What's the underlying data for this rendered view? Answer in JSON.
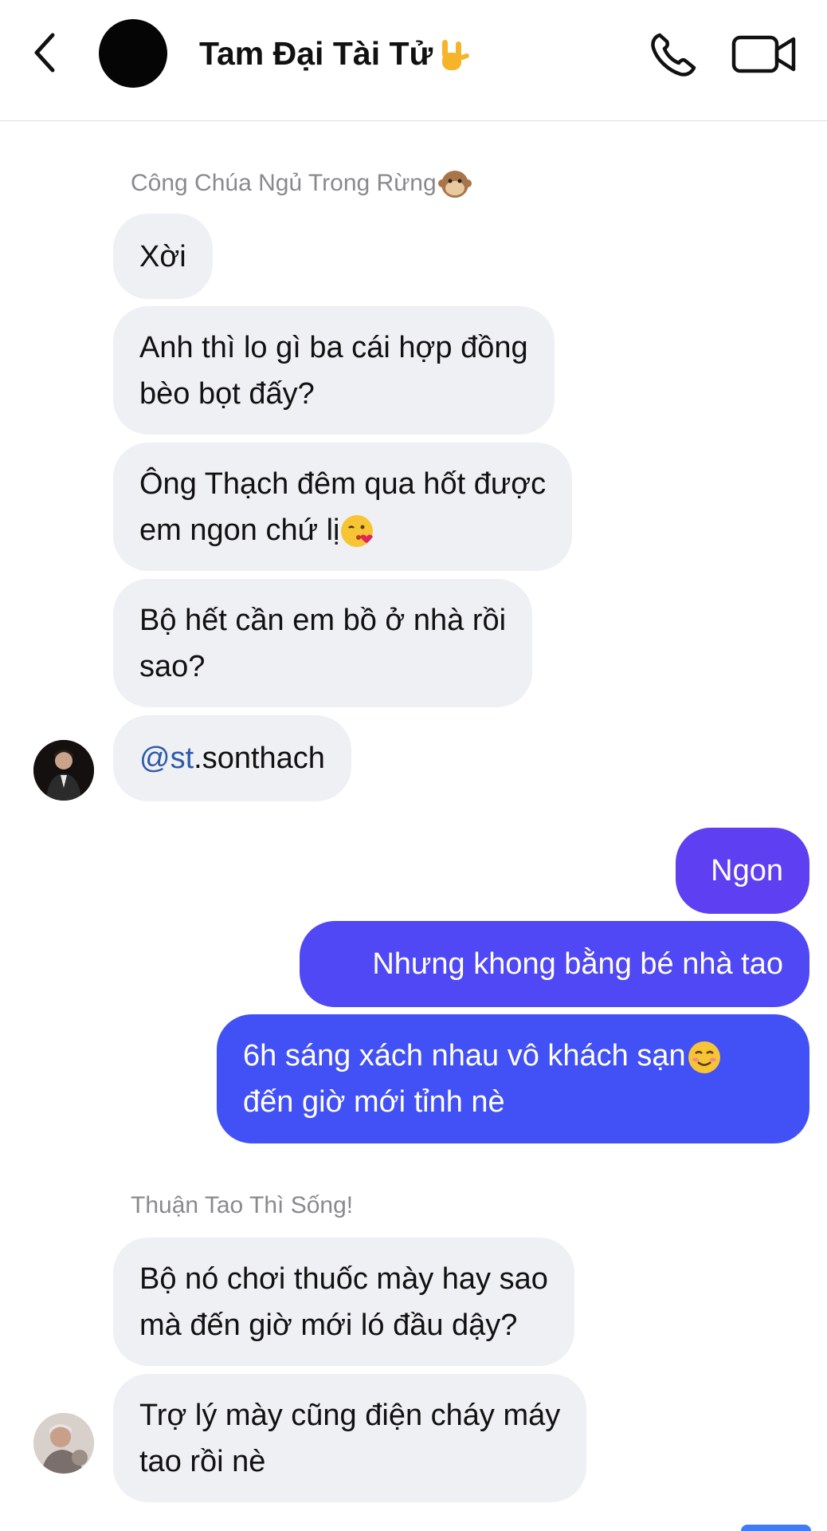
{
  "header": {
    "title": "Tam Đại Tài Tử",
    "title_emoji_icon": "rock-on-hand-icon"
  },
  "colors": {
    "incoming_bubble": "#eff0f4",
    "outgoing_bubble_top": "#6a3cf0",
    "outgoing_bubble_bottom": "#3f55f5",
    "mention": "#2f5aa8"
  },
  "groups": [
    {
      "sender": "Công Chúa Ngủ Trong Rừng",
      "sender_emoji_icon": "monkey-face-icon",
      "messages": [
        {
          "lines": [
            "Xời"
          ]
        },
        {
          "lines": [
            "Anh thì lo gì ba cái hợp đồng",
            "bèo bọt đấy?"
          ]
        },
        {
          "lines": [
            "Ông Thạch đêm qua hốt được",
            "em ngon chứ lị"
          ],
          "emoji_icon": "face-blowing-kiss-icon"
        },
        {
          "lines": [
            "Bộ hết cần em bồ ở nhà rồi",
            "sao?"
          ]
        },
        {
          "mention": "@st",
          "text": ".sonthach"
        }
      ]
    },
    {
      "sender": "me",
      "messages": [
        {
          "lines": [
            "Ngon"
          ]
        },
        {
          "lines": [
            "Nhưng khong bằng bé nhà tao"
          ]
        },
        {
          "lines": [
            "6h sáng xách nhau vô khách sạn",
            "đến giờ mới tỉnh nè"
          ],
          "emoji_icon": "smiling-face-icon"
        }
      ]
    },
    {
      "sender": "Thuận Tao Thì Sống!",
      "messages": [
        {
          "lines": [
            "Bộ nó chơi thuốc mày hay sao",
            "mà đến giờ mới ló đầu dậy?"
          ]
        },
        {
          "lines": [
            "Trợ lý mày cũng điện cháy máy",
            "tao rồi nè"
          ]
        }
      ]
    }
  ]
}
